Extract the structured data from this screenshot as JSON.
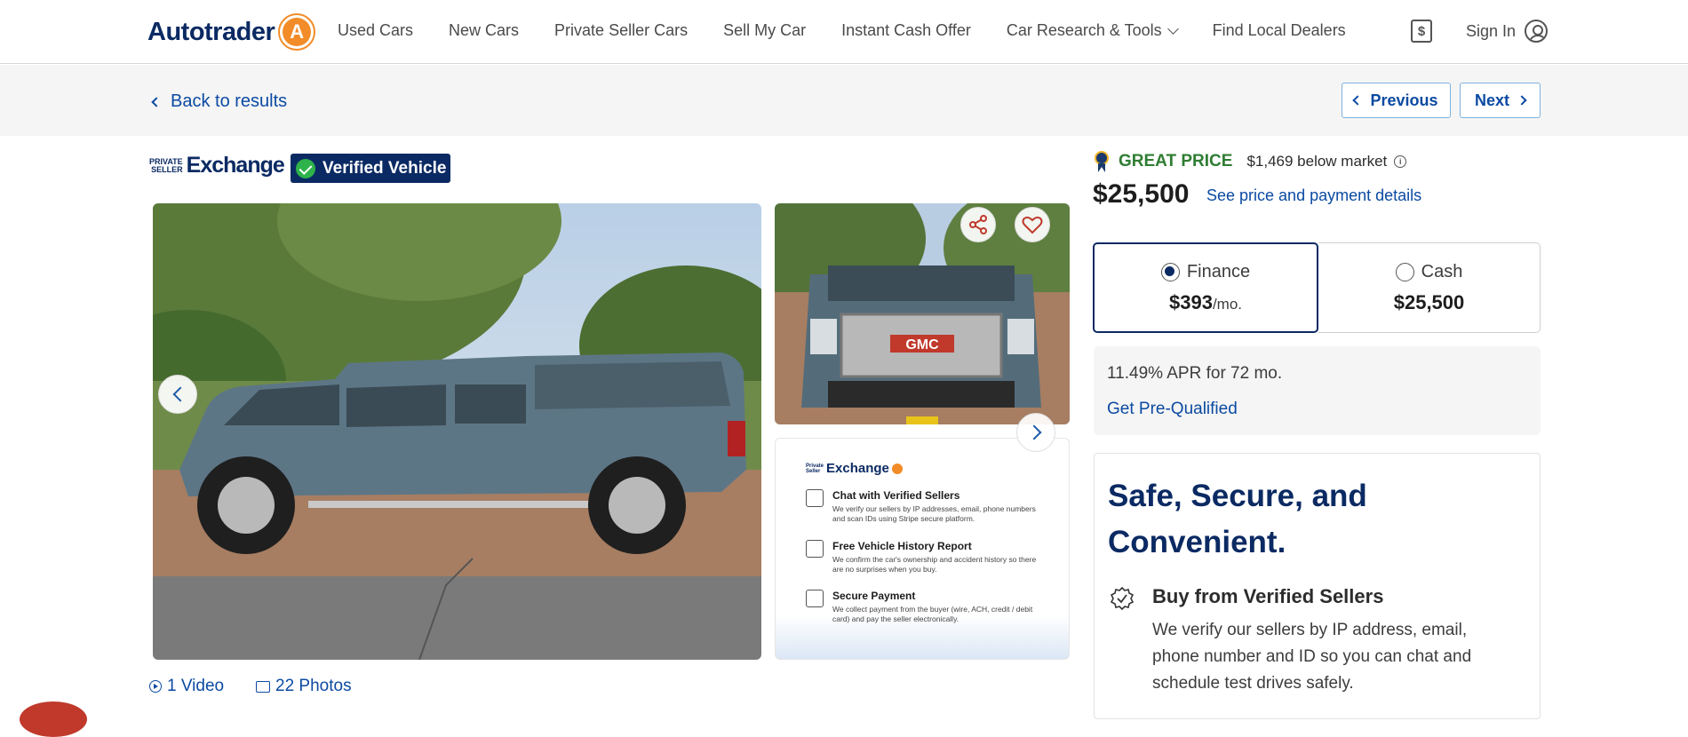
{
  "header": {
    "logo_text": "Autotrader",
    "nav": [
      {
        "label": "Used Cars"
      },
      {
        "label": "New Cars"
      },
      {
        "label": "Private Seller Cars"
      },
      {
        "label": "Sell My Car"
      },
      {
        "label": "Instant Cash Offer"
      },
      {
        "label": "Car Research & Tools"
      },
      {
        "label": "Find Local Dealers"
      }
    ],
    "sign_in": "Sign In"
  },
  "subbar": {
    "back": "Back to results",
    "previous": "Previous",
    "next": "Next"
  },
  "badges": {
    "pse_small_1": "PRIVATE",
    "pse_small_2": "SELLER",
    "pse_big": "Exchange",
    "verified": "Verified Vehicle"
  },
  "gallery": {
    "info_card": {
      "brand_small_1": "Private",
      "brand_small_2": "Seller",
      "brand": "Exchange",
      "items": [
        {
          "title": "Chat with Verified Sellers",
          "desc": "We verify our sellers by IP addresses, email, phone numbers and scan IDs using Stripe secure platform."
        },
        {
          "title": "Free Vehicle History Report",
          "desc": "We confirm the car's ownership and accident history so there are no surprises when you buy."
        },
        {
          "title": "Secure Payment",
          "desc": "We collect payment from the buyer (wire, ACH, credit / debit card) and pay the seller electronically."
        }
      ]
    },
    "video_link": "1 Video",
    "photos_link": "22 Photos"
  },
  "pricing": {
    "rating": "GREAT PRICE",
    "below_market": "$1,469 below market",
    "price": "$25,500",
    "see_details": "See price and payment details",
    "finance_label": "Finance",
    "finance_value": "$393",
    "finance_unit": "/mo.",
    "cash_label": "Cash",
    "cash_value": "$25,500",
    "apr": "11.49% APR for 72 mo.",
    "prequalify": "Get Pre-Qualified"
  },
  "safe": {
    "title": "Safe, Secure, and Convenient.",
    "heading": "Buy from Verified Sellers",
    "body": "We verify our sellers by IP address, email, phone number and ID so you can chat and schedule test drives safely."
  },
  "colors": {
    "brand_navy": "#0b2a63",
    "link_blue": "#0b4aa2",
    "great_green": "#2e7d32",
    "logo_orange": "#f28c28"
  }
}
